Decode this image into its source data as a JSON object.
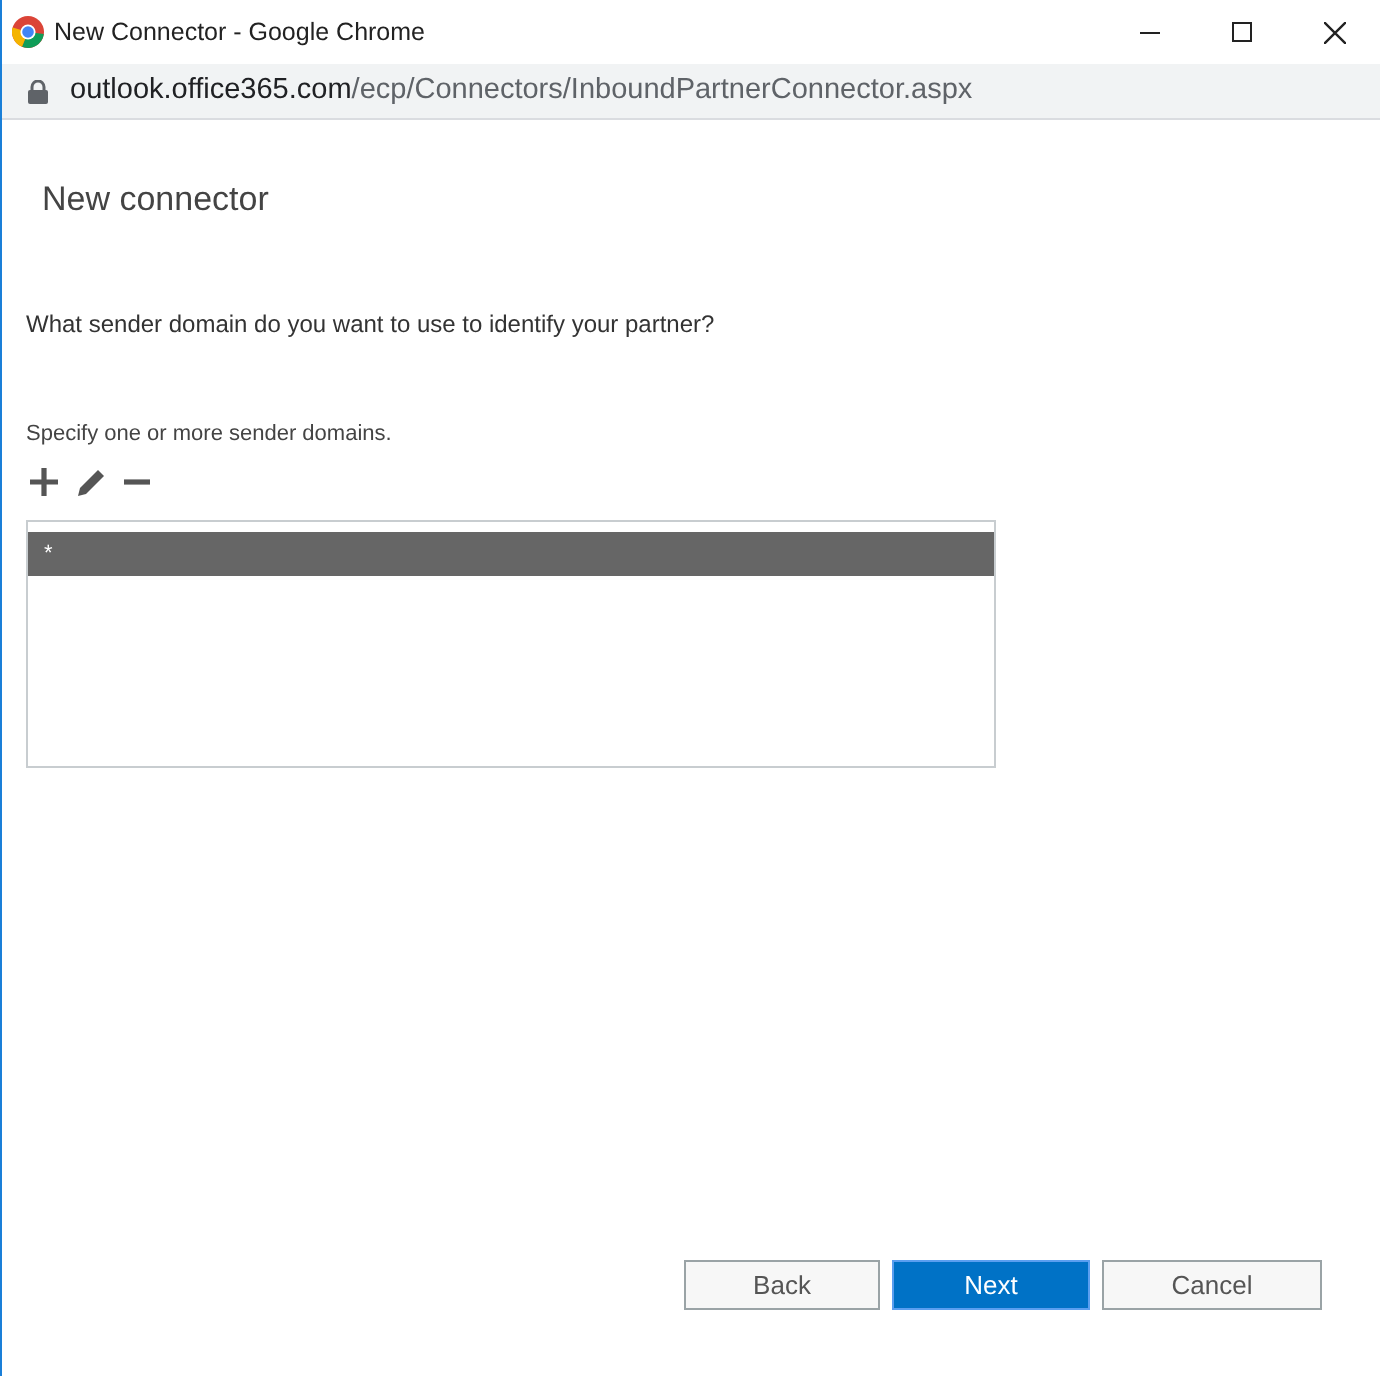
{
  "window": {
    "title": "New Connector - Google Chrome"
  },
  "address_bar": {
    "host": "outlook.office365.com",
    "path": "/ecp/Connectors/InboundPartnerConnector.aspx"
  },
  "heading": "New connector",
  "question": "What sender domain do you want to use to identify your partner?",
  "instruction": "Specify one or more sender domains.",
  "domains": [
    {
      "text": "*",
      "selected": true
    }
  ],
  "buttons": [
    {
      "label": "Back",
      "kind": "default"
    },
    {
      "label": "Next",
      "kind": "primary"
    },
    {
      "label": "Cancel",
      "kind": "default"
    }
  ]
}
